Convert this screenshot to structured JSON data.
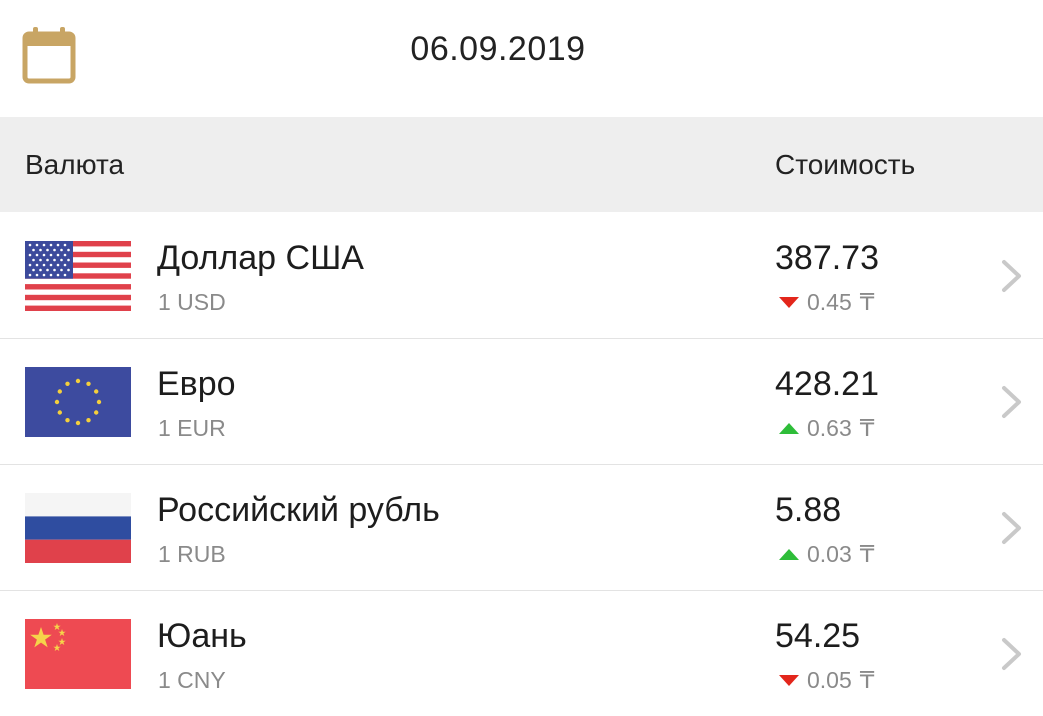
{
  "date": "06.09.2019",
  "header": {
    "currency_label": "Валюта",
    "price_label": "Стоимость"
  },
  "colors": {
    "accent": "#c8a564",
    "down": "#e3261b",
    "up": "#2ebd39"
  },
  "rows": [
    {
      "name": "Доллар США",
      "code": "1 USD",
      "rate": "387.73",
      "change": "0.45",
      "direction": "down",
      "currency_symbol": "₸",
      "flag": "us-flag-icon"
    },
    {
      "name": "Евро",
      "code": "1 EUR",
      "rate": "428.21",
      "change": "0.63",
      "direction": "up",
      "currency_symbol": "₸",
      "flag": "eu-flag-icon"
    },
    {
      "name": "Российский рубль",
      "code": "1 RUB",
      "rate": "5.88",
      "change": "0.03",
      "direction": "up",
      "currency_symbol": "₸",
      "flag": "ru-flag-icon"
    },
    {
      "name": "Юань",
      "code": "1 CNY",
      "rate": "54.25",
      "change": "0.05",
      "direction": "down",
      "currency_symbol": "₸",
      "flag": "cn-flag-icon"
    }
  ]
}
